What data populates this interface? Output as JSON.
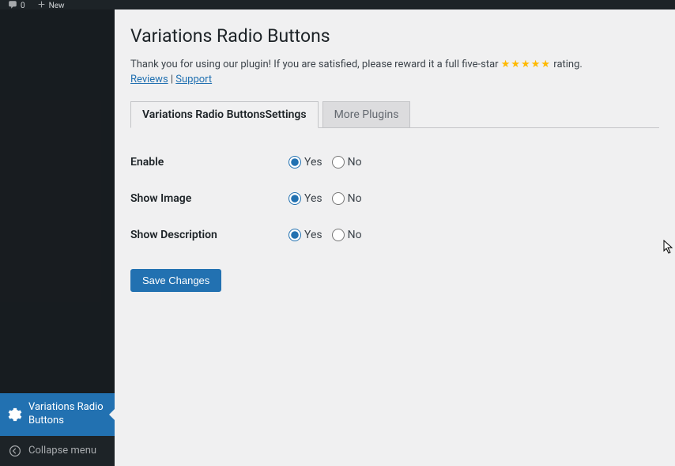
{
  "adminbar": {
    "comments_count": "0",
    "new_label": "New"
  },
  "page": {
    "title": "Variations Radio Buttons",
    "notice_pre": "Thank you for using our plugin! If you are satisfied, please reward it a full five-star ",
    "notice_stars": "★★★★★",
    "notice_post": " rating.",
    "reviews_label": "Reviews",
    "separator": " | ",
    "support_label": "Support"
  },
  "tabs": {
    "settings": "Variations Radio ButtonsSettings",
    "more_plugins": "More Plugins"
  },
  "form": {
    "enable_label": "Enable",
    "show_image_label": "Show Image",
    "show_desc_label": "Show Description",
    "yes": "Yes",
    "no": "No"
  },
  "buttons": {
    "save": "Save Changes"
  },
  "sidebar": {
    "active_label": "Variations Radio Buttons",
    "collapse_label": "Collapse menu"
  }
}
